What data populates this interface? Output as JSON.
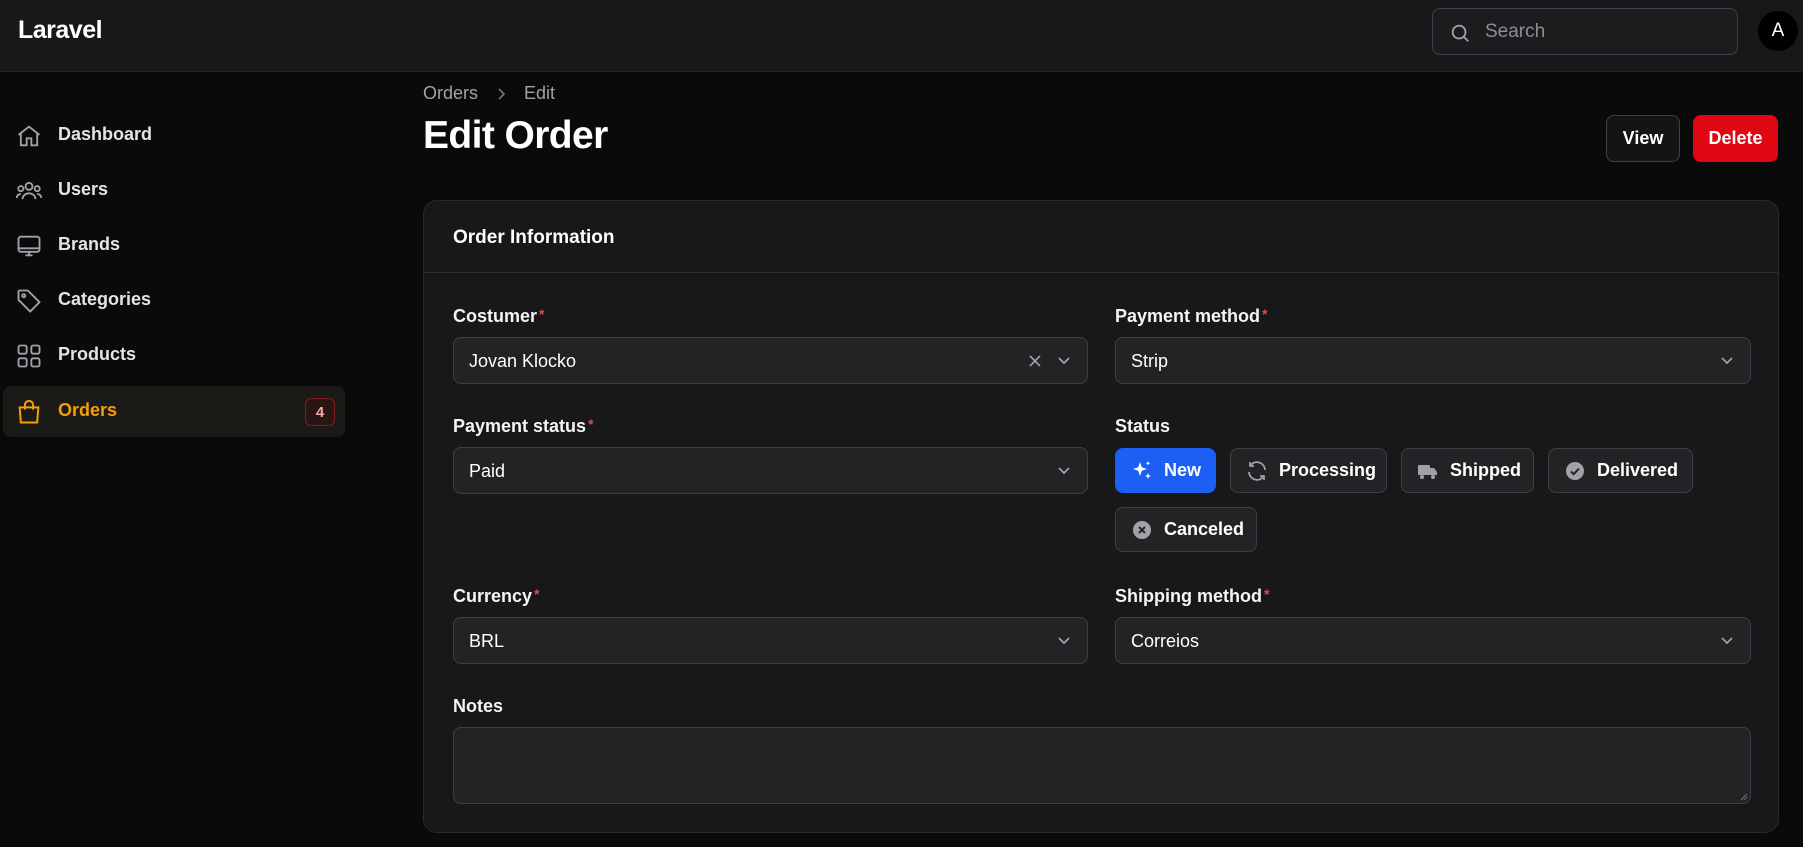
{
  "app": {
    "name": "Laravel"
  },
  "search": {
    "placeholder": "Search"
  },
  "user": {
    "avatar_initial": "A"
  },
  "sidebar": {
    "items": [
      {
        "label": "Dashboard",
        "icon": "home-icon"
      },
      {
        "label": "Users",
        "icon": "users-icon"
      },
      {
        "label": "Brands",
        "icon": "monitor-icon"
      },
      {
        "label": "Categories",
        "icon": "tag-icon"
      },
      {
        "label": "Products",
        "icon": "grid-icon"
      },
      {
        "label": "Orders",
        "icon": "shopping-bag-icon",
        "active": true,
        "badge": "4"
      }
    ]
  },
  "breadcrumb": {
    "items": [
      "Orders",
      "Edit"
    ]
  },
  "page": {
    "title": "Edit Order"
  },
  "actions": {
    "view": "View",
    "delete": "Delete"
  },
  "colors": {
    "accent": "#f59e0b",
    "primary": "#1d5ff5",
    "danger": "#e00712"
  },
  "form": {
    "section_title": "Order Information",
    "costumer": {
      "label": "Costumer",
      "value": "Jovan Klocko"
    },
    "payment_method": {
      "label": "Payment method",
      "value": "Strip"
    },
    "payment_status": {
      "label": "Payment status",
      "value": "Paid"
    },
    "status": {
      "label": "Status",
      "options": [
        {
          "label": "New",
          "icon": "sparkles-icon",
          "selected": true
        },
        {
          "label": "Processing",
          "icon": "refresh-icon"
        },
        {
          "label": "Shipped",
          "icon": "truck-icon"
        },
        {
          "label": "Delivered",
          "icon": "check-badge-icon"
        },
        {
          "label": "Canceled",
          "icon": "x-circle-icon"
        }
      ]
    },
    "currency": {
      "label": "Currency",
      "value": "BRL"
    },
    "shipping_method": {
      "label": "Shipping method",
      "value": "Correios"
    },
    "notes": {
      "label": "Notes",
      "value": ""
    },
    "required_marker": "*"
  }
}
